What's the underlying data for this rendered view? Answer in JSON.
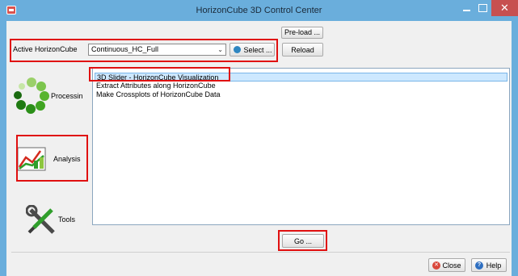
{
  "window": {
    "title": "HorizonCube 3D Control Center",
    "controls": {
      "minimize": "–",
      "maximize": "□",
      "close": "✕"
    }
  },
  "toolbar": {
    "preload_label": "Pre-load ...",
    "active_label": "Active HorizonCube",
    "active_value": "Continuous_HC_Full",
    "select_label": "Select ...",
    "reload_label": "Reload"
  },
  "sidebar": {
    "items": [
      {
        "label": "Processin",
        "icon": "processing-spinner-icon"
      },
      {
        "label": "Analysis",
        "icon": "analysis-chart-icon"
      },
      {
        "label": "Tools",
        "icon": "tools-wrench-screwdriver-icon"
      }
    ]
  },
  "list": {
    "items": [
      "3D Slider - HorizonCube Visualization",
      "Extract Attributes along HorizonCube",
      "Make Crossplots of HorizonCube Data"
    ],
    "selected_index": 0
  },
  "actions": {
    "go_label": "Go ...",
    "close_label": "Close",
    "help_label": "Help"
  },
  "colors": {
    "titlebar": "#6aaedc",
    "highlight": "#e01010",
    "selection": "#cde8ff"
  }
}
